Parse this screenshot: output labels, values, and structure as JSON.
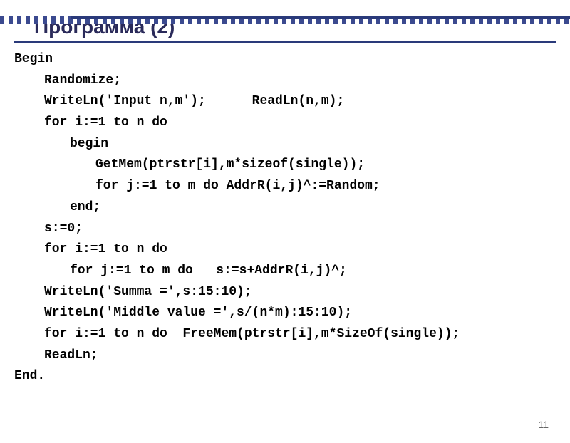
{
  "slide": {
    "title": "Программа (2)",
    "page_number": "11",
    "code_lines": [
      {
        "text": "Begin",
        "indent": 0
      },
      {
        "text": "Randomize;",
        "indent": 1
      },
      {
        "text": "WriteLn('Input n,m');      ReadLn(n,m);",
        "indent": 1
      },
      {
        "text": "for i:=1 to n do",
        "indent": 1
      },
      {
        "text": "begin",
        "indent": 2
      },
      {
        "text": "GetMem(ptrstr[i],m*sizeof(single));",
        "indent": 3
      },
      {
        "text": "for j:=1 to m do AddrR(i,j)^:=Random;",
        "indent": 3
      },
      {
        "text": "end;",
        "indent": 2
      },
      {
        "text": "s:=0;",
        "indent": 1
      },
      {
        "text": "for i:=1 to n do",
        "indent": 1
      },
      {
        "text": "for j:=1 to m do   s:=s+AddrR(i,j)^;",
        "indent": 2
      },
      {
        "text": "WriteLn('Summa =',s:15:10);",
        "indent": 1
      },
      {
        "text": "WriteLn('Middle value =',s/(n*m):15:10);",
        "indent": 1
      },
      {
        "text": "for i:=1 to n do  FreeMem(ptrstr[i],m*SizeOf(single));",
        "indent": 1
      },
      {
        "text": "ReadLn;",
        "indent": 1
      },
      {
        "text": "End.",
        "indent": 0
      }
    ]
  }
}
